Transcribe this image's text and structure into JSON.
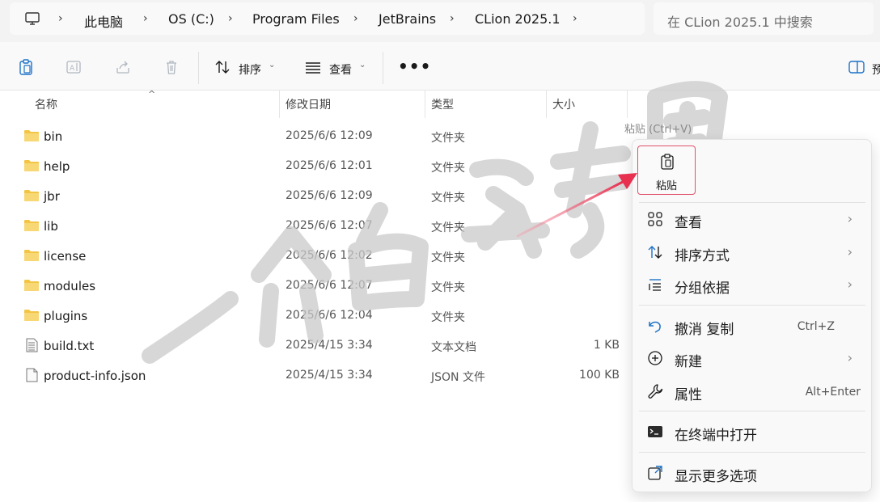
{
  "address_bar": {
    "crumbs": [
      "此电脑",
      "OS (C:)",
      "Program Files",
      "JetBrains",
      "CLion 2025.1"
    ],
    "search_placeholder": "在 CLion 2025.1 中搜索"
  },
  "toolbar": {
    "sort_label": "排序",
    "view_label": "查看",
    "preview_label": "预"
  },
  "columns": [
    "名称",
    "修改日期",
    "类型",
    "大小"
  ],
  "files": [
    {
      "name": "bin",
      "date": "2025/6/6 12:09",
      "type": "文件夹",
      "size": "",
      "icon": "folder-icon"
    },
    {
      "name": "help",
      "date": "2025/6/6 12:01",
      "type": "文件夹",
      "size": "",
      "icon": "folder-icon"
    },
    {
      "name": "jbr",
      "date": "2025/6/6 12:09",
      "type": "文件夹",
      "size": "",
      "icon": "folder-icon"
    },
    {
      "name": "lib",
      "date": "2025/6/6 12:07",
      "type": "文件夹",
      "size": "",
      "icon": "folder-icon"
    },
    {
      "name": "license",
      "date": "2025/6/6 12:02",
      "type": "文件夹",
      "size": "",
      "icon": "folder-icon"
    },
    {
      "name": "modules",
      "date": "2025/6/6 12:07",
      "type": "文件夹",
      "size": "",
      "icon": "folder-icon"
    },
    {
      "name": "plugins",
      "date": "2025/6/6 12:04",
      "type": "文件夹",
      "size": "",
      "icon": "folder-icon"
    },
    {
      "name": "build.txt",
      "date": "2025/4/15 3:34",
      "type": "文本文档",
      "size": "1 KB",
      "icon": "text-file-icon"
    },
    {
      "name": "product-info.json",
      "date": "2025/4/15 3:34",
      "type": "JSON 文件",
      "size": "100 KB",
      "icon": "file-icon"
    }
  ],
  "tooltip": "粘贴 (Ctrl+V)",
  "context_menu": {
    "paste_label": "粘贴",
    "items": [
      {
        "label": "查看",
        "icon": "grid-icon",
        "submenu": true
      },
      {
        "label": "排序方式",
        "icon": "sort-icon",
        "submenu": true
      },
      {
        "label": "分组依据",
        "icon": "group-icon",
        "submenu": true
      },
      {
        "label": "撤消 复制",
        "icon": "undo-icon",
        "shortcut": "Ctrl+Z"
      },
      {
        "label": "新建",
        "icon": "new-icon",
        "submenu": true
      },
      {
        "label": "属性",
        "icon": "wrench-icon",
        "shortcut": "Alt+Enter"
      },
      {
        "label": "在终端中打开",
        "icon": "terminal-icon"
      },
      {
        "label": "显示更多选项",
        "icon": "more-options-icon"
      }
    ]
  },
  "watermark": "一介白衣专用",
  "colors": {
    "folder": "#f3c545",
    "highlight": "#e0506a",
    "accent": "#1e73c8"
  }
}
